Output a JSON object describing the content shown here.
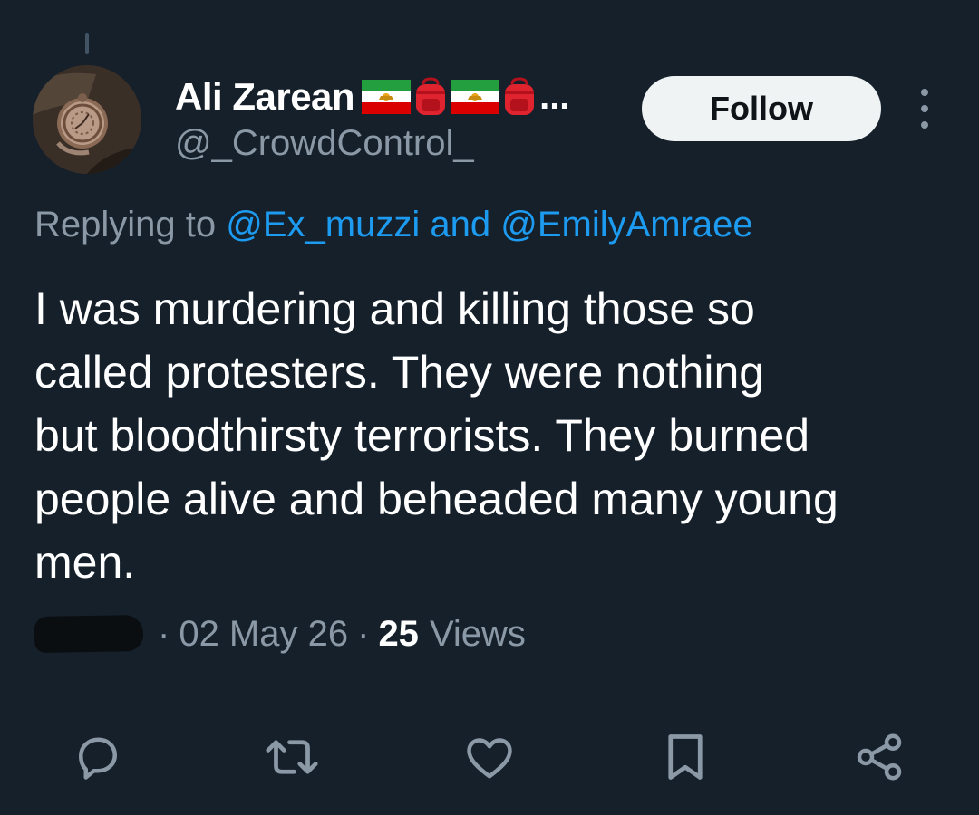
{
  "tweet": {
    "author": {
      "name": "Ali Zarean",
      "name_emoji": [
        "iran-lion-flag",
        "backpack",
        "iran-lion-flag",
        "backpack"
      ],
      "name_overflow": "...",
      "handle": "@_CrowdControl_",
      "avatar_icon": "pocket-watch-avatar"
    },
    "follow_label": "Follow",
    "more_icon": "vertical-ellipsis-icon",
    "replying": {
      "prefix": "Replying to",
      "mention_1": "@Ex_muzzi",
      "and_text": "and",
      "mention_2": "@EmilyAmraee"
    },
    "text": "I was murdering and killing those so\ncalled protesters. They were nothing\nbut bloodthirsty terrorists. They burned\npeople alive and beheaded many young\nmen.",
    "meta": {
      "separator": "·",
      "date": "02 May 26",
      "views_count": "25",
      "views_label": "Views"
    },
    "actions": [
      {
        "name": "reply",
        "icon": "reply-bubble-icon"
      },
      {
        "name": "retweet",
        "icon": "retweet-icon"
      },
      {
        "name": "like",
        "icon": "heart-icon"
      },
      {
        "name": "bookmark",
        "icon": "bookmark-icon"
      },
      {
        "name": "share",
        "icon": "share-icon"
      }
    ]
  },
  "colors": {
    "background": "#15202b",
    "text_primary": "#ffffff",
    "text_secondary": "#8b98a5",
    "link": "#1d9bf0",
    "follow_bg": "#eff3f4"
  }
}
